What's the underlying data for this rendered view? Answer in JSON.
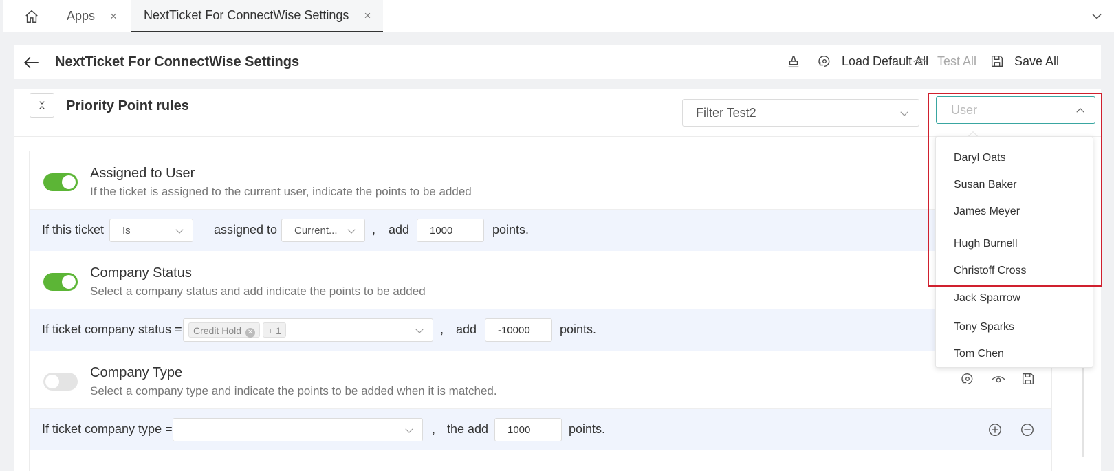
{
  "tabs": {
    "home_icon": "home-icon",
    "items": [
      {
        "label": "Apps"
      },
      {
        "label": "NextTicket For ConnectWise Settings"
      }
    ],
    "close_glyph": "×"
  },
  "header": {
    "title": "NextTicket For ConnectWise Settings",
    "load_default_label": "Load Default All",
    "test_label": "Test All",
    "save_label": "Save All"
  },
  "section": {
    "title": "Priority Point rules",
    "filter_value": "Filter Test2",
    "user_placeholder": "User"
  },
  "rules": [
    {
      "title": "Assigned to User",
      "description": "If the ticket is assigned to the current user, indicate the points to be added",
      "enabled": true,
      "condition": {
        "prefix": "If this ticket",
        "operator": "Is",
        "middle": "assigned to",
        "target": "Current...",
        "comma": ",",
        "add_label": "add",
        "points": "1000",
        "suffix": "points."
      }
    },
    {
      "title": "Company Status",
      "description": "Select a company status and add indicate the points to be added",
      "enabled": true,
      "condition": {
        "prefix": "If ticket company status =",
        "tag": "Credit Hold",
        "more": "+ 1",
        "comma": ",",
        "add_label": "add",
        "points": "-10000",
        "suffix": "points."
      }
    },
    {
      "title": "Company Type",
      "description": "Select a company type and indicate the points to be added when it is matched.",
      "enabled": false,
      "condition": {
        "prefix": "If ticket company type =",
        "comma": ",",
        "add_label": "the add",
        "points": "1000",
        "suffix": "points."
      }
    }
  ],
  "user_dropdown": {
    "options": [
      "Daryl Oats",
      "Susan Baker",
      "James Meyer",
      "Hugh Burnell",
      "Christoff Cross",
      "Jack Sparrow",
      "Tony Sparks",
      "Tom Chen"
    ]
  },
  "colors": {
    "toggle_on": "#5cb536",
    "focus": "#39a6a1",
    "highlight": "#d0202e",
    "condition_bg": "#f0f4fd"
  }
}
